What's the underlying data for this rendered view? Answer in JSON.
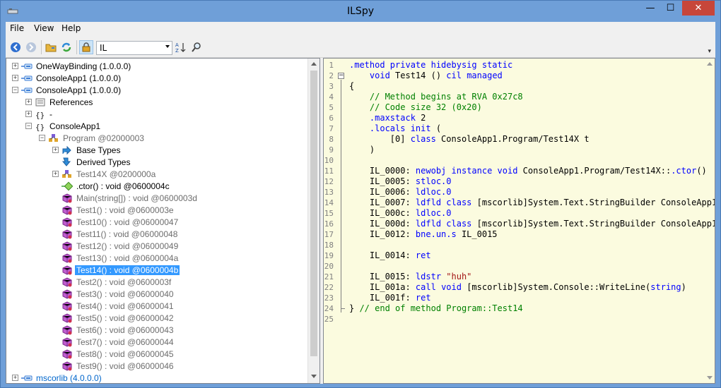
{
  "window": {
    "title": "ILSpy",
    "min_glyph": "—",
    "max_glyph": "☐",
    "close_glyph": "✕"
  },
  "menu": {
    "items": [
      {
        "label": "File"
      },
      {
        "label": "View"
      },
      {
        "label": "Help"
      }
    ]
  },
  "toolbar": {
    "language": "IL"
  },
  "tree": {
    "rows": [
      {
        "label": "OneWayBinding (1.0.0.0)",
        "icon": "assembly-icon",
        "exp": "+",
        "style": ""
      },
      {
        "label": "ConsoleApp1 (1.0.0.0)",
        "icon": "assembly-icon",
        "exp": "+",
        "style": ""
      },
      {
        "label": "ConsoleApp1 (1.0.0.0)",
        "icon": "assembly-icon",
        "exp": "−",
        "style": ""
      },
      {
        "label": "References",
        "icon": "references-icon",
        "exp": "+",
        "style": ""
      },
      {
        "label": "-",
        "icon": "namespace-icon",
        "exp": "+",
        "style": ""
      },
      {
        "label": "ConsoleApp1",
        "icon": "namespace-icon",
        "exp": "−",
        "style": ""
      },
      {
        "label": "Program @02000003",
        "icon": "class-icon",
        "exp": "−",
        "style": "grey"
      },
      {
        "label": "Base Types",
        "icon": "base-types-icon",
        "exp": "+",
        "style": ""
      },
      {
        "label": "Derived Types",
        "icon": "derived-types-icon",
        "exp": "",
        "style": ""
      },
      {
        "label": "Test14X @0200000a",
        "icon": "class-icon",
        "exp": "+",
        "style": "grey"
      },
      {
        "label": ".ctor() : void @0600004c",
        "icon": "ctor-icon",
        "exp": "",
        "style": ""
      },
      {
        "label": "Main(string[]) : void @0600003d",
        "icon": "method-icon",
        "exp": "",
        "style": "grey"
      },
      {
        "label": "Test1() : void @0600003e",
        "icon": "method-icon",
        "exp": "",
        "style": "grey"
      },
      {
        "label": "Test10() : void @06000047",
        "icon": "method-icon",
        "exp": "",
        "style": "grey"
      },
      {
        "label": "Test11() : void @06000048",
        "icon": "method-icon",
        "exp": "",
        "style": "grey"
      },
      {
        "label": "Test12() : void @06000049",
        "icon": "method-icon",
        "exp": "",
        "style": "grey"
      },
      {
        "label": "Test13() : void @0600004a",
        "icon": "method-icon",
        "exp": "",
        "style": "grey"
      },
      {
        "label": "Test14() : void @0600004b",
        "icon": "method-icon",
        "exp": "",
        "style": "selected"
      },
      {
        "label": "Test2() : void @0600003f",
        "icon": "method-icon",
        "exp": "",
        "style": "grey"
      },
      {
        "label": "Test3() : void @06000040",
        "icon": "method-icon",
        "exp": "",
        "style": "grey"
      },
      {
        "label": "Test4() : void @06000041",
        "icon": "method-icon",
        "exp": "",
        "style": "grey"
      },
      {
        "label": "Test5() : void @06000042",
        "icon": "method-icon",
        "exp": "",
        "style": "grey"
      },
      {
        "label": "Test6() : void @06000043",
        "icon": "method-icon",
        "exp": "",
        "style": "grey"
      },
      {
        "label": "Test7() : void @06000044",
        "icon": "method-icon",
        "exp": "",
        "style": "grey"
      },
      {
        "label": "Test8() : void @06000045",
        "icon": "method-icon",
        "exp": "",
        "style": "grey"
      },
      {
        "label": "Test9() : void @06000046",
        "icon": "method-icon",
        "exp": "",
        "style": "grey"
      },
      {
        "label": "mscorlib (4.0.0.0)",
        "icon": "assembly-icon",
        "exp": "+",
        "style": "blue"
      }
    ]
  },
  "code": {
    "lines": [
      [
        {
          "t": ".method private hidebysig static",
          "c": "kw"
        }
      ],
      [
        {
          "t": "    "
        },
        {
          "t": "void",
          "c": "kw"
        },
        {
          "t": " Test14 () "
        },
        {
          "t": "cil managed",
          "c": "kw"
        }
      ],
      [
        {
          "t": "{"
        }
      ],
      [
        {
          "t": "    // Method begins at RVA 0x27c8",
          "c": "cm"
        }
      ],
      [
        {
          "t": "    // Code size 32 (0x20)",
          "c": "cm"
        }
      ],
      [
        {
          "t": "    "
        },
        {
          "t": ".maxstack",
          "c": "kw"
        },
        {
          "t": " 2"
        }
      ],
      [
        {
          "t": "    "
        },
        {
          "t": ".locals init",
          "c": "kw"
        },
        {
          "t": " ("
        }
      ],
      [
        {
          "t": "        [0] "
        },
        {
          "t": "class",
          "c": "kw"
        },
        {
          "t": " ConsoleApp1.Program/Test14X t"
        }
      ],
      [
        {
          "t": "    )"
        }
      ],
      [
        {
          "t": ""
        }
      ],
      [
        {
          "t": "    IL_0000: "
        },
        {
          "t": "newobj",
          "c": "kw"
        },
        {
          "t": " "
        },
        {
          "t": "instance",
          "c": "kw"
        },
        {
          "t": " "
        },
        {
          "t": "void",
          "c": "kw"
        },
        {
          "t": " ConsoleApp1.Program/Test14X::"
        },
        {
          "t": ".ctor",
          "c": "kw"
        },
        {
          "t": "()"
        }
      ],
      [
        {
          "t": "    IL_0005: "
        },
        {
          "t": "stloc.0",
          "c": "kw"
        }
      ],
      [
        {
          "t": "    IL_0006: "
        },
        {
          "t": "ldloc.0",
          "c": "kw"
        }
      ],
      [
        {
          "t": "    IL_0007: "
        },
        {
          "t": "ldfld",
          "c": "kw"
        },
        {
          "t": " "
        },
        {
          "t": "class",
          "c": "kw"
        },
        {
          "t": " [mscorlib]System.Text.StringBuilder ConsoleApp1"
        }
      ],
      [
        {
          "t": "    IL_000c: "
        },
        {
          "t": "ldloc.0",
          "c": "kw"
        }
      ],
      [
        {
          "t": "    IL_000d: "
        },
        {
          "t": "ldfld",
          "c": "kw"
        },
        {
          "t": " "
        },
        {
          "t": "class",
          "c": "kw"
        },
        {
          "t": " [mscorlib]System.Text.StringBuilder ConsoleApp1"
        }
      ],
      [
        {
          "t": "    IL_0012: "
        },
        {
          "t": "bne.un.s",
          "c": "kw"
        },
        {
          "t": " IL_0015"
        }
      ],
      [
        {
          "t": ""
        }
      ],
      [
        {
          "t": "    IL_0014: "
        },
        {
          "t": "ret",
          "c": "kw"
        }
      ],
      [
        {
          "t": ""
        }
      ],
      [
        {
          "t": "    IL_0015: "
        },
        {
          "t": "ldstr",
          "c": "kw"
        },
        {
          "t": " "
        },
        {
          "t": "\"huh\"",
          "c": "str"
        }
      ],
      [
        {
          "t": "    IL_001a: "
        },
        {
          "t": "call",
          "c": "kw"
        },
        {
          "t": " "
        },
        {
          "t": "void",
          "c": "kw"
        },
        {
          "t": " [mscorlib]System.Console::WriteLine("
        },
        {
          "t": "string",
          "c": "kw"
        },
        {
          "t": ")"
        }
      ],
      [
        {
          "t": "    IL_001f: "
        },
        {
          "t": "ret",
          "c": "kw"
        }
      ],
      [
        {
          "t": "} "
        },
        {
          "t": "// end of method Program::Test14",
          "c": "cm"
        }
      ],
      [
        {
          "t": ""
        }
      ]
    ]
  }
}
